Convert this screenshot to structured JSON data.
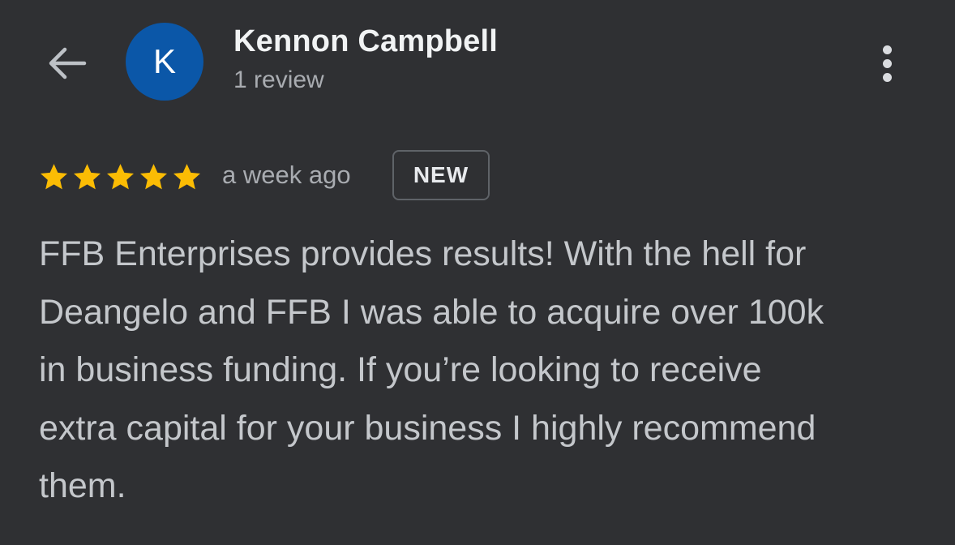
{
  "header": {
    "back_icon": "arrow-left-icon",
    "avatar_letter": "K",
    "avatar_color": "#0b57a8",
    "reviewer_name": "Kennon Campbell",
    "review_count": "1 review",
    "more_icon": "more-vert-icon"
  },
  "review": {
    "rating": 5,
    "rating_max": 5,
    "star_color": "#fbbc04",
    "time_ago": "a week ago",
    "badge": "NEW",
    "text": "FFB Enterprises provides results! With the hell for\nDeangelo and FFB I was able to acquire over 100k\nin business funding. If you’re looking to receive\nextra capital for your business I highly recommend\nthem."
  }
}
